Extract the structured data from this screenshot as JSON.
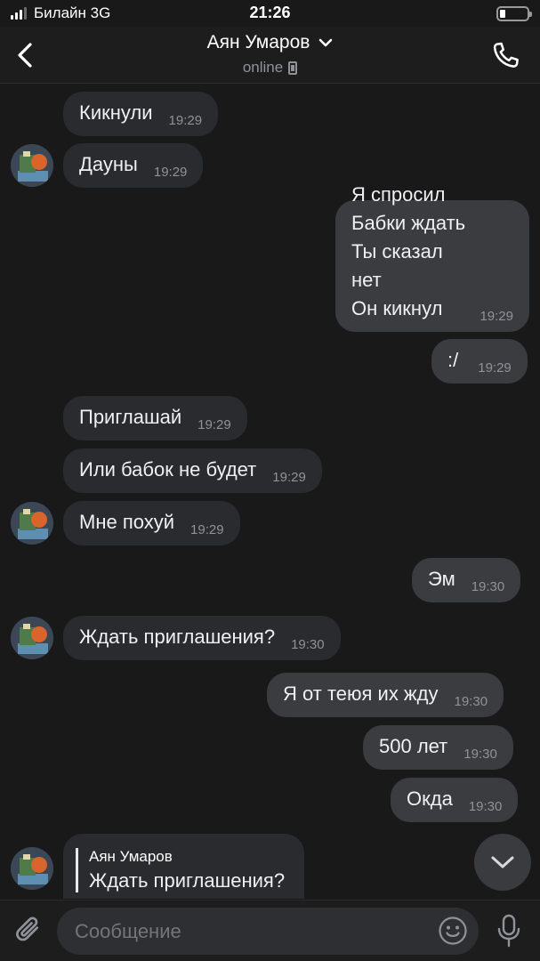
{
  "status_bar": {
    "carrier": "Билайн 3G",
    "time": "21:26"
  },
  "header": {
    "name": "Аян Умаров",
    "status": "online"
  },
  "messages": [
    {
      "dir": "in",
      "text": "Кикнули",
      "time": "19:29"
    },
    {
      "dir": "in",
      "text": "Дауны",
      "time": "19:29"
    },
    {
      "dir": "out",
      "text": "Я спросил\nБабки ждать\nТы сказал нет\nОн кикнул",
      "time": "19:29"
    },
    {
      "dir": "out",
      "text": ":/",
      "time": "19:29"
    },
    {
      "dir": "in",
      "text": "Приглашай",
      "time": "19:29"
    },
    {
      "dir": "in",
      "text": "Или бабок не будет",
      "time": "19:29"
    },
    {
      "dir": "in",
      "text": "Мне похуй",
      "time": "19:29"
    },
    {
      "dir": "out",
      "text": "Эм",
      "time": "19:30"
    },
    {
      "dir": "in",
      "text": "Ждать приглашения?",
      "time": "19:30"
    },
    {
      "dir": "out",
      "text": "Я от теюя их жду",
      "time": "19:30"
    },
    {
      "dir": "out",
      "text": "500 лет",
      "time": "19:30"
    },
    {
      "dir": "out",
      "text": "Окда",
      "time": "19:30"
    }
  ],
  "reply": {
    "author": "Аян Умаров",
    "text": "Ждать приглашения?"
  },
  "composer": {
    "placeholder": "Сообщение"
  },
  "icons": {
    "back": "chevron-left-icon",
    "title_dropdown": "chevron-down-icon",
    "call": "phone-icon",
    "scroll_down": "chevron-down-icon",
    "attach": "paperclip-icon",
    "emoji": "smiley-icon",
    "mic": "microphone-icon"
  }
}
